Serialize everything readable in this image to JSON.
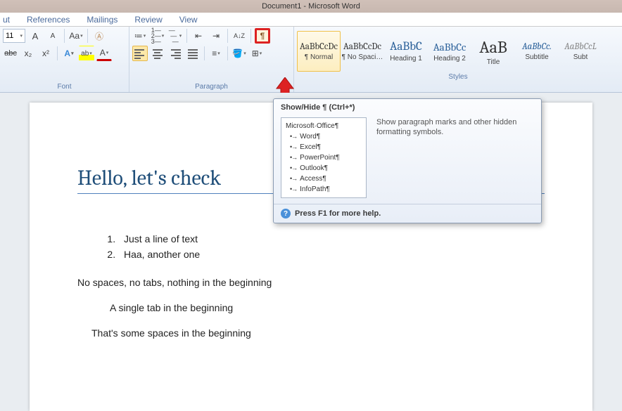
{
  "titlebar": "Document1 - Microsoft Word",
  "tabs": [
    "ut",
    "References",
    "Mailings",
    "Review",
    "View"
  ],
  "font": {
    "size": "11",
    "grow": "A",
    "shrink": "A",
    "case": "Aa",
    "clear": "✖",
    "strike": "abc",
    "sub": "x₂",
    "sup": "x²",
    "texteffects": "A",
    "highlight": "ab",
    "fontcolor": "A",
    "group_label": "Font"
  },
  "para": {
    "bullets": "•",
    "numbers": "1",
    "multilevel": "⋮",
    "indent_dec": "◀",
    "indent_inc": "▶",
    "sort": "A↓Z",
    "pilcrow": "¶",
    "linespace": "↕",
    "fill": "◧",
    "borders": "▦",
    "group_label": "Paragraph"
  },
  "styles": {
    "tiles": [
      {
        "preview": "AaBbCcDc",
        "name": "¶ Normal",
        "sel": true,
        "psize": "13px",
        "pcolor": "#333"
      },
      {
        "preview": "AaBbCcDc",
        "name": "¶ No Spaci…",
        "psize": "13px",
        "pcolor": "#333"
      },
      {
        "preview": "AaBbC",
        "name": "Heading 1",
        "psize": "17px",
        "pcolor": "#2a6099"
      },
      {
        "preview": "AaBbCc",
        "name": "Heading 2",
        "psize": "15px",
        "pcolor": "#2a6099"
      },
      {
        "preview": "AaB",
        "name": "Title",
        "psize": "24px",
        "pcolor": "#333"
      },
      {
        "preview": "AaBbCc.",
        "name": "Subtitle",
        "psize": "13px",
        "pcolor": "#2a6099",
        "pstyle": "italic"
      },
      {
        "preview": "AaBbCcL",
        "name": "Subt",
        "psize": "13px",
        "pcolor": "#888",
        "pstyle": "italic"
      }
    ],
    "group_label": "Styles"
  },
  "tooltip": {
    "title": "Show/Hide ¶ (Ctrl+*)",
    "thumb_header": "Microsoft·Office¶",
    "thumb_items": [
      "Word¶",
      "Excel¶",
      "PowerPoint¶",
      "Outlook¶",
      "Access¶",
      "InfoPath¶"
    ],
    "desc": "Show paragraph marks and other hidden formatting symbols.",
    "footer": "Press F1 for more help."
  },
  "doc": {
    "title": "Hello, let's check",
    "list": [
      "Just a line of text",
      "Haa, another one"
    ],
    "p1": "No spaces, no tabs, nothing in the beginning",
    "p2": "A single tab in the beginning",
    "p3": "That's some spaces in the beginning"
  }
}
